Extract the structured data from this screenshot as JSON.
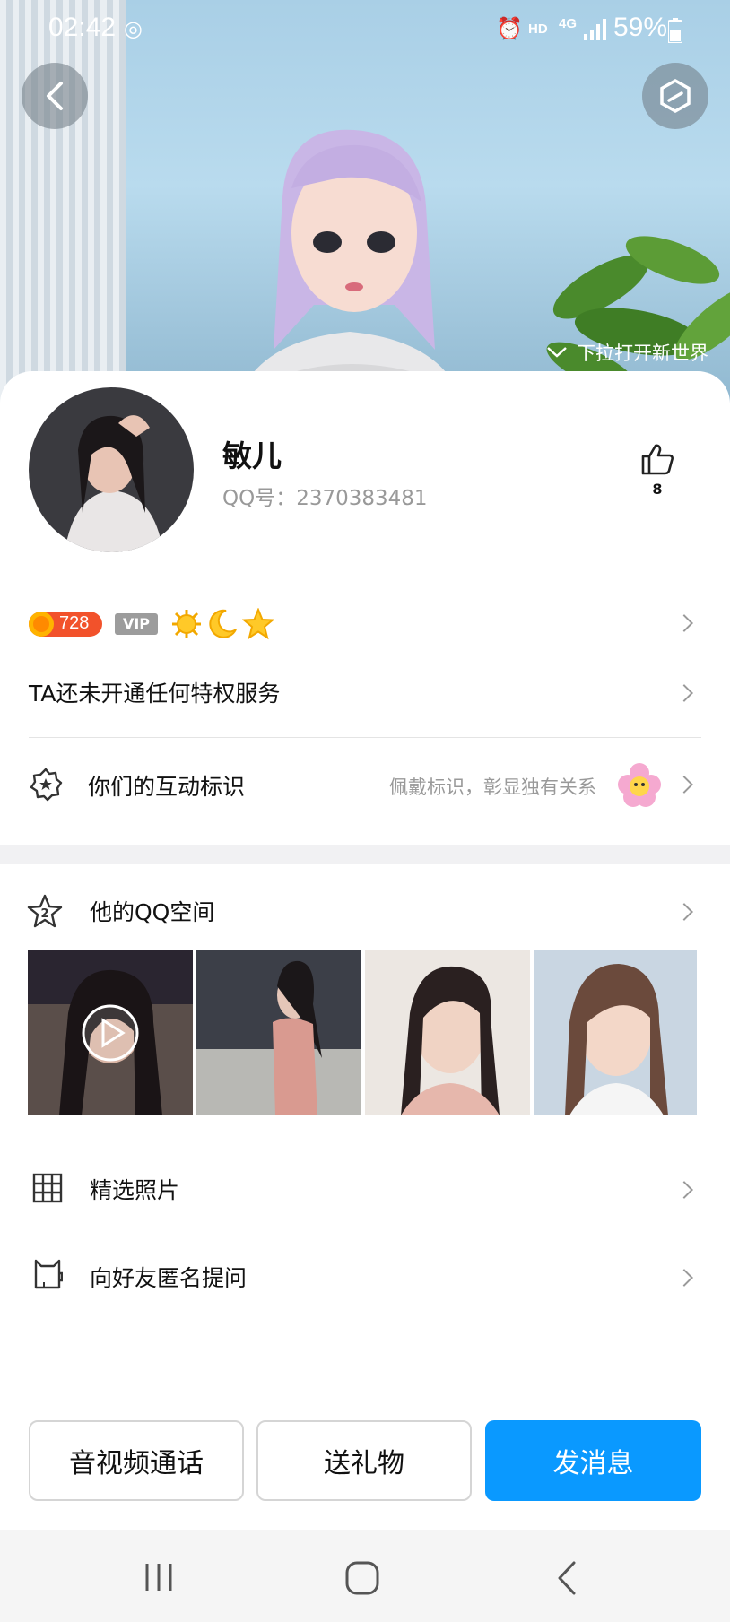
{
  "status_bar": {
    "time": "02:42",
    "hd": "HD",
    "network": "4G",
    "battery": "59%"
  },
  "hero": {
    "pull_hint": "下拉打开新世界"
  },
  "profile": {
    "name": "敏儿",
    "qq_label": "QQ号：",
    "qq_number": "2370383481",
    "like_count": "8"
  },
  "badges": {
    "level": "728",
    "vip": "VIP"
  },
  "rows": {
    "privilege": "TA还未开通任何特权服务",
    "interaction_label": "你们的互动标识",
    "interaction_hint": "佩戴标识，彰显独有关系",
    "qzone": "他的QQ空间",
    "photos": "精选照片",
    "anonymous_question": "向好友匿名提问"
  },
  "buttons": {
    "call": "音视频通话",
    "gift": "送礼物",
    "message": "发消息"
  },
  "colors": {
    "primary_blue": "#0a99ff",
    "level_orange": "#f2522b",
    "vip_gray": "#9c9c9c"
  }
}
